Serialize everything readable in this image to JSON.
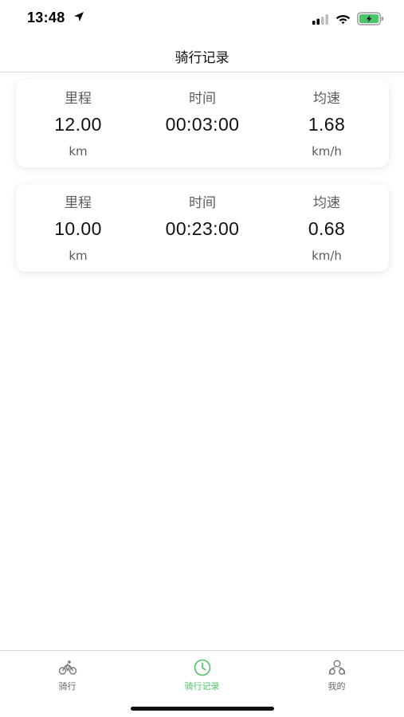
{
  "status_bar": {
    "time": "13:48",
    "icons": [
      "location-arrow-icon",
      "signal-icon",
      "wifi-icon",
      "battery-charging-icon"
    ]
  },
  "nav": {
    "title": "骑行记录"
  },
  "records": [
    {
      "distance_label": "里程",
      "distance_value": "12.00",
      "distance_unit": "km",
      "time_label": "时间",
      "time_value": "00:03:00",
      "speed_label": "均速",
      "speed_value": "1.68",
      "speed_unit": "km/h"
    },
    {
      "distance_label": "里程",
      "distance_value": "10.00",
      "distance_unit": "km",
      "time_label": "时间",
      "time_value": "00:23:00",
      "speed_label": "均速",
      "speed_value": "0.68",
      "speed_unit": "km/h"
    }
  ],
  "tab_bar": {
    "tabs": [
      {
        "label": "骑行",
        "icon": "bicycle-icon",
        "active": false
      },
      {
        "label": "骑行记录",
        "icon": "clock-icon",
        "active": true
      },
      {
        "label": "我的",
        "icon": "profile-icon",
        "active": false
      }
    ]
  },
  "colors": {
    "accent": "#4cc46a",
    "battery_fill": "#4cc46a",
    "text_primary": "#111111",
    "text_secondary": "#5b5b5b"
  }
}
